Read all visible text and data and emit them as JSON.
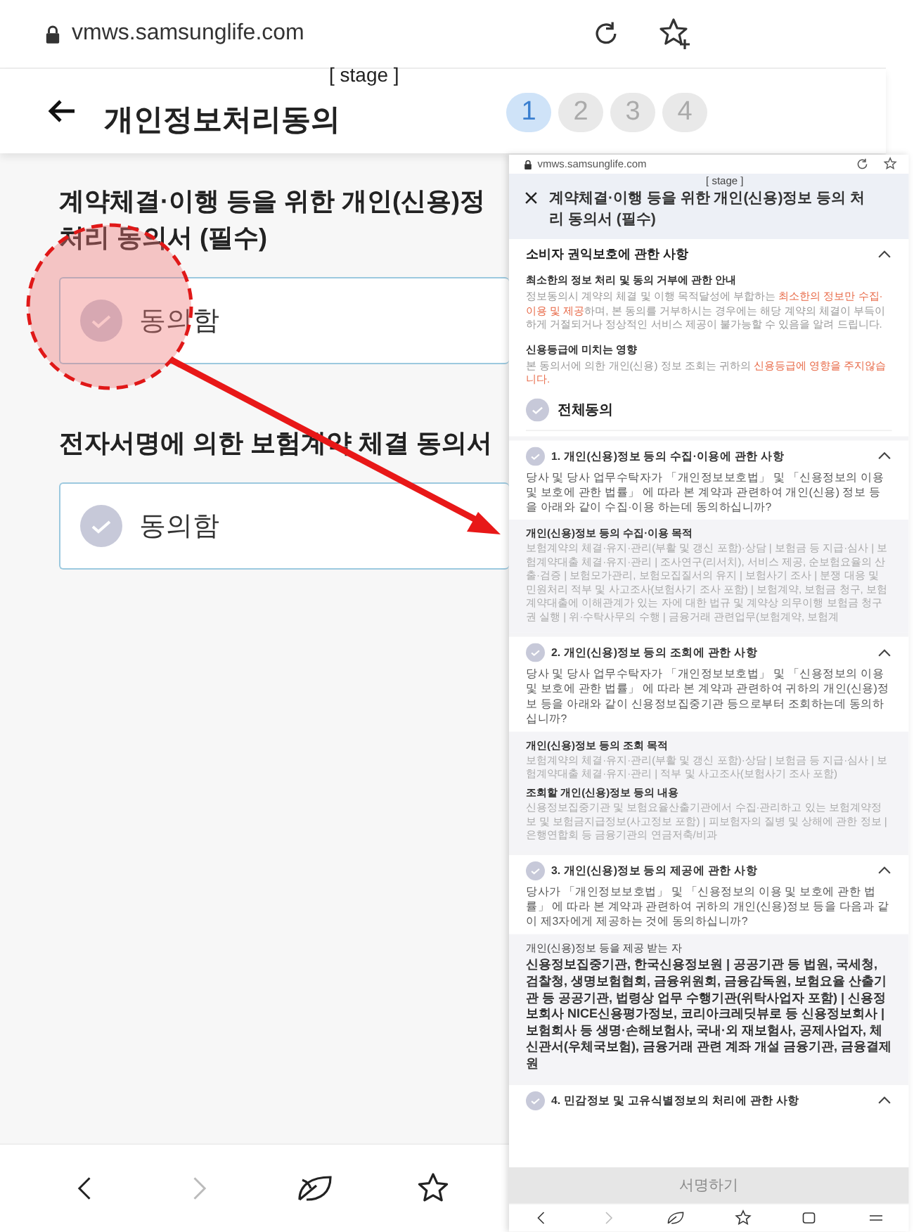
{
  "url": "vmws.samsunglife.com",
  "header": {
    "title": "개인정보처리동의",
    "stage_label": "[ stage ]",
    "steps": [
      {
        "label": "1",
        "selected": true
      },
      {
        "label": "2",
        "selected": false
      },
      {
        "label": "3",
        "selected": false
      },
      {
        "label": "4",
        "selected": false
      }
    ]
  },
  "sections": [
    {
      "heading_lines": [
        "계약체결·이행 등을 위한 개인(신용)정",
        "처리 동의서 (필수)"
      ],
      "agree": {
        "label": "동의함",
        "checked": false
      }
    },
    {
      "heading_lines": [
        "전자서명에 의한 보험계약 체결 동의서"
      ],
      "agree": {
        "label": "동의함",
        "checked": false
      }
    }
  ],
  "inset": {
    "url": "vmws.samsunglife.com",
    "stage_label": "[ stage ]",
    "title": "계약체결·이행 등을 위한 개인(신용)정보 등의 처리 동의서 (필수)",
    "notice": {
      "title": "소비자 권익보호에 관한 사항",
      "expanded": true,
      "blocks": [
        {
          "heading": "최소한의 정보 처리 및 동의 거부에 관한 안내",
          "segments": [
            {
              "text": "정보동의시 계약의 체결 및 이행 목적달성에 부합하는 ",
              "highlight": false
            },
            {
              "text": "최소한의 정보만 수집·이용 및 제공",
              "highlight": true
            },
            {
              "text": "하며, 본 동의를 거부하시는 경우에는 해당 계약의 체결이 부득이하게 거절되거나 정상적인 서비스 제공이 불가능할 수 있음을 알려 드립니다.",
              "highlight": false
            }
          ]
        },
        {
          "heading": "신용등급에 미치는 영향",
          "segments": [
            {
              "text": "본 동의서에 의한 개인(신용) 정보 조회는 귀하의 ",
              "highlight": false
            },
            {
              "text": "신용등급에 영향을 주지않습니다.",
              "highlight": true
            }
          ]
        }
      ]
    },
    "agree_all": {
      "label": "전체동의",
      "checked": false
    },
    "items": [
      {
        "title": "1. 개인(신용)정보 등의 수집·이용에 관한 사항",
        "checked": false,
        "expanded": true,
        "question": "당사 및 당사 업무수탁자가 「개인정보보호법」 및 「신용정보의 이용 및 보호에 관한 법률」 에 따라 본 계약과 관련하여 개인(신용) 정보 등을 아래와 같이 수집·이용 하는데 동의하십니까?",
        "details": [
          {
            "heading": "개인(신용)정보 등의 수집·이용 목적",
            "kind": "muted",
            "text": "보험계약의 체결·유지·관리(부활 및 갱신 포함)·상담 | 보험금 등 지급·심사 | 보험계약대출 체결·유지·관리 | 조사연구(리서치), 서비스 제공, 순보험요율의 산출·검증 | 보험모가관리, 보험모집질서의 유지 | 보험사기 조사 | 분쟁 대응 및 민원처리 적부 및 사고조사(보험사기 조사 포함) | 보험계약, 보험금 청구, 보험계약대출에 이해관계가 있는 자에 대한 법규 및 계약상 의무이행 보험금 청구권 실행 | 위·수탁사무의 수행 | 금융거래 관련업무(보험계약, 보험계"
          }
        ]
      },
      {
        "title": "2. 개인(신용)정보 등의 조회에 관한 사항",
        "checked": false,
        "expanded": true,
        "question": "당사 및 당사 업무수탁자가 「개인정보보호법」 및 「신용정보의 이용 및 보호에 관한 법률」 에 따라 본 계약과 관련하여 귀하의 개인(신용)정보 등을 아래와 같이 신용정보집중기관 등으로부터 조회하는데 동의하십니까?",
        "details": [
          {
            "heading": "개인(신용)정보 등의 조회 목적",
            "kind": "muted",
            "text": "보험계약의 체결·유지·관리(부활 및 갱신 포함)·상담 | 보험금 등 지급·심사 | 보험계약대출 체결·유지·관리 | 적부 및 사고조사(보험사기 조사 포함)"
          },
          {
            "heading": "조회할 개인(신용)정보 등의 내용",
            "kind": "muted",
            "text": "신용정보집중기관 및 보험요율산출기관에서 수집·관리하고 있는 보험계약정보 및 보험금지급정보(사고정보 포함) | 피보험자의 질병 및 상해에 관한 정보 | 은행연합회 등 금융기관의 연금저축/비과"
          }
        ]
      },
      {
        "title": "3. 개인(신용)정보 등의 제공에 관한 사항",
        "checked": false,
        "expanded": true,
        "question": "당사가 「개인정보보호법」 및 「신용정보의 이용 및 보호에 관한 법률」 에 따라 본 계약과 관련하여 귀하의 개인(신용)정보 등을 다음과 같이 제3자에게 제공하는 것에 동의하십니까?",
        "details": [
          {
            "heading": "개인(신용)정보 등을 제공 받는 자",
            "kind": "strong",
            "text": "신용정보집중기관, 한국신용정보원 | 공공기관 등 법원, 국세청, 검찰청, 생명보험협회, 금융위원회, 금융감독원, 보험요율 산출기관 등 공공기관, 법령상 업무 수행기관(위탁사업자 포함) | 신용정보회사 NICE신용평가정보, 코리아크레딧뷰로 등 신용정보회사 | 보험회사 등 생명·손해보험사, 국내·외 재보험사, 공제사업자, 체신관서(우체국보험), 금융거래 관련 계좌 개설 금융기관, 금융결제원"
          }
        ]
      },
      {
        "title": "4. 민감정보 및 고유식별정보의 처리에 관한 사항",
        "checked": false,
        "expanded": true
      }
    ],
    "button": {
      "label": "서명하기",
      "disabled": true
    }
  }
}
